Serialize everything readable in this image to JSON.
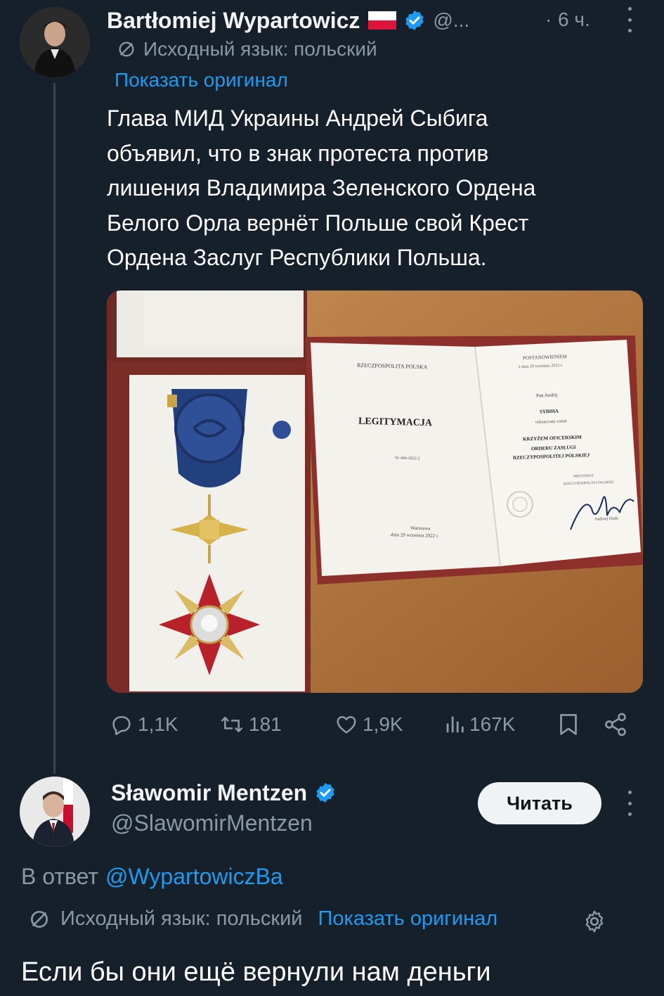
{
  "tweet1": {
    "author_name": "Bartłomiej Wypartowicz",
    "handle": "@...",
    "dot": "·",
    "time": "6 ч.",
    "translated_from": "Исходный язык: польский",
    "show_original": "Показать оригинал",
    "text_lines": [
      "Глава МИД Украины Андрей Сыбига",
      "объявил, что в знак протеста против",
      "лишения Владимира Зеленского Ордена",
      "Белого Орла вернёт Польше свой Крест",
      "Ордена Заслуг Республики Польша."
    ],
    "document": {
      "left_header": "RZECZPOSPOLITA POLSKA",
      "title": "LEGITYMACJA",
      "number": "Nr 446-2022-2",
      "place": "Warszawa",
      "date": "dnia 29 września 2022 r.",
      "right_header": "POSTANOWIENIEM",
      "right_date": "z dnia 29 września 2022 r.",
      "pan": "Pan Andrij",
      "surname": "SYBIHA",
      "awarded": "odznaczony został",
      "award1": "KRZYŻEM OFICERSKIM",
      "award2": "ORDERU ZASŁUGI",
      "award3": "RZECZYPOSPOLITEJ POLSKIEJ",
      "president": "PREZYDENT",
      "president2": "RZECZYPOSPOLITEJ POLSKIEJ",
      "signer": "Andrzej Duda"
    },
    "stats": {
      "replies": "1,1K",
      "retweets": "181",
      "likes": "1,9K",
      "views": "167K"
    }
  },
  "tweet2": {
    "author_name": "Sławomir Mentzen",
    "handle": "@SlawomirMentzen",
    "follow_label": "Читать",
    "reply_to_prefix": "В ответ",
    "reply_to_handle": "@WypartowiczBa",
    "translated_from": "Исходный язык: польский",
    "show_original": "Показать оригинал",
    "text": "Если бы они ещё вернули нам деньги"
  },
  "colors": {
    "background": "#15202b",
    "accent": "#1d9bf0",
    "muted": "#8b98a5"
  }
}
